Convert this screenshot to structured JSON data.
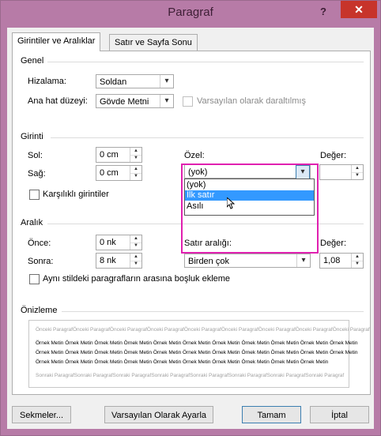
{
  "window": {
    "title": "Paragraf",
    "help_label": "?",
    "close_label": "✕"
  },
  "tabs": [
    {
      "label": "Girintiler ve Aralıklar",
      "active": true
    },
    {
      "label": "Satır ve Sayfa Sonu",
      "active": false
    }
  ],
  "genel": {
    "heading": "Genel",
    "alignment_label": "Hizalama:",
    "alignment_value": "Soldan",
    "outline_label": "Ana hat düzeyi:",
    "outline_value": "Gövde Metni",
    "collapsed_label": "Varsayılan olarak daraltılmış"
  },
  "girinti": {
    "heading": "Girinti",
    "left_label": "Sol:",
    "left_value": "0 cm",
    "right_label": "Sağ:",
    "right_value": "0 cm",
    "mirror_label": "Karşılıklı girintiler",
    "special_label": "Özel:",
    "special_value": "(yok)",
    "special_options": [
      "(yok)",
      "İlk satır",
      "Asılı"
    ],
    "special_highlighted": "İlk satır",
    "by_label": "Değer:",
    "by_value": ""
  },
  "aralik": {
    "heading": "Aralık",
    "before_label": "Önce:",
    "before_value": "0 nk",
    "after_label": "Sonra:",
    "after_value": "8 nk",
    "line_spacing_label": "Satır aralığı:",
    "line_spacing_value": "Birden çok",
    "at_label": "Değer:",
    "at_value": "1,08",
    "same_style_label": "Aynı stildeki paragrafların arasına boşluk ekleme"
  },
  "preview": {
    "heading": "Önizleme",
    "prev_para": "Önceki ParagrafÖnceki ParagrafÖnceki ParagrafÖnceki ParagrafÖnceki ParagrafÖnceki ParagrafÖnceki ParagrafÖnceki ParagrafÖnceki Paragraf",
    "sample_line1": "Örnek Metin Örnek Metin Örnek Metin Örnek Metin Örnek Metin Örnek Metin Örnek Metin Örnek Metin Örnek Metin Örnek Metin Örnek Metin",
    "sample_line2": "Örnek Metin Örnek Metin Örnek Metin Örnek Metin Örnek Metin Örnek Metin Örnek Metin Örnek Metin Örnek Metin Örnek Metin Örnek Metin",
    "sample_line3": "Örnek Metin Örnek Metin Örnek Metin Örnek Metin Örnek Metin Örnek Metin Örnek Metin Örnek Metin Örnek Metin Örnek Metin",
    "next_para": "Sonraki ParagrafSonraki ParagrafSonraki ParagrafSonraki ParagrafSonraki ParagrafSonraki ParagrafSonraki ParagrafSonraki Paragraf"
  },
  "buttons": {
    "tabs": "Sekmeler...",
    "default": "Varsayılan Olarak Ayarla",
    "ok": "Tamam",
    "cancel": "İptal"
  },
  "colors": {
    "titlebar": "#b77ba7",
    "close": "#c7342b",
    "highlight_box": "#e020b0",
    "selection": "#3399ff"
  }
}
